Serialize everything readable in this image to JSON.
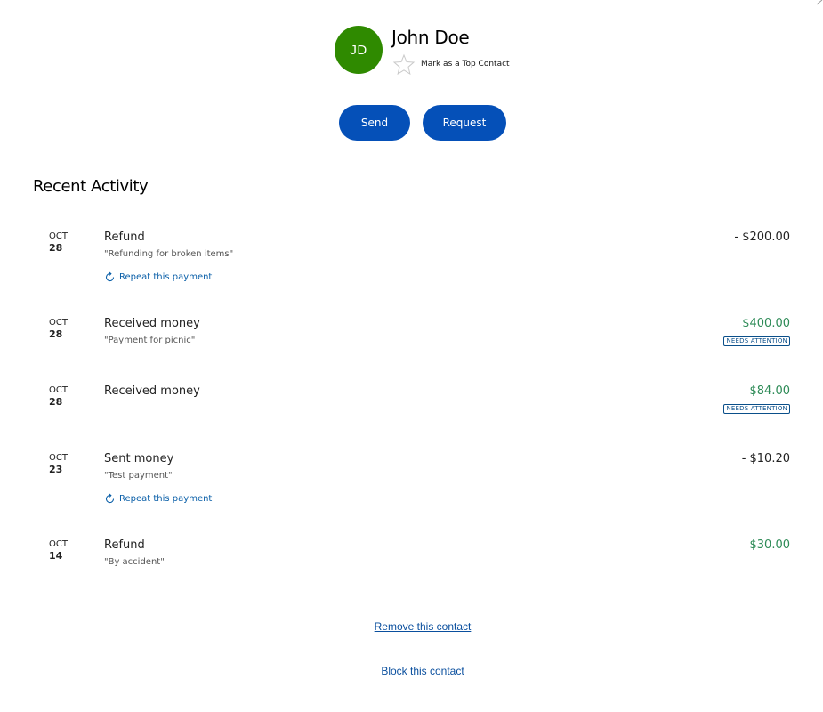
{
  "contact": {
    "initials": "JD",
    "name": "John Doe",
    "avatar_color": "#2f8a00",
    "top_contact_label": "Mark as a Top Contact",
    "star_icon": "star-outline-icon"
  },
  "actions": {
    "send_label": "Send",
    "request_label": "Request",
    "button_color": "#0550b8"
  },
  "activity": {
    "title": "Recent Activity",
    "repeat_label": "Repeat this payment",
    "items": [
      {
        "month": "OCT",
        "day": "28",
        "title": "Refund",
        "note": "\"Refunding for broken items\"",
        "amount": "- $200.00",
        "direction": "negative",
        "repeatable": true
      },
      {
        "month": "OCT",
        "day": "28",
        "title": "Received money",
        "note": "\"Payment for picnic\"",
        "amount": "$400.00",
        "direction": "positive",
        "badge": "NEEDS ATTENTION"
      },
      {
        "month": "OCT",
        "day": "28",
        "title": "Received money",
        "note": "",
        "amount": "$84.00",
        "direction": "positive",
        "badge": "NEEDS ATTENTION"
      },
      {
        "month": "OCT",
        "day": "23",
        "title": "Sent money",
        "note": "\"Test payment\"",
        "amount": "- $10.20",
        "direction": "negative",
        "repeatable": true
      },
      {
        "month": "OCT",
        "day": "14",
        "title": "Refund",
        "note": "\"By accident\"",
        "amount": "$30.00",
        "direction": "positive"
      }
    ]
  },
  "footer": {
    "remove_label": "Remove this contact",
    "block_label": "Block this contact"
  },
  "colors": {
    "positive_amount": "#2e8b57",
    "link": "#0a5fa8"
  }
}
